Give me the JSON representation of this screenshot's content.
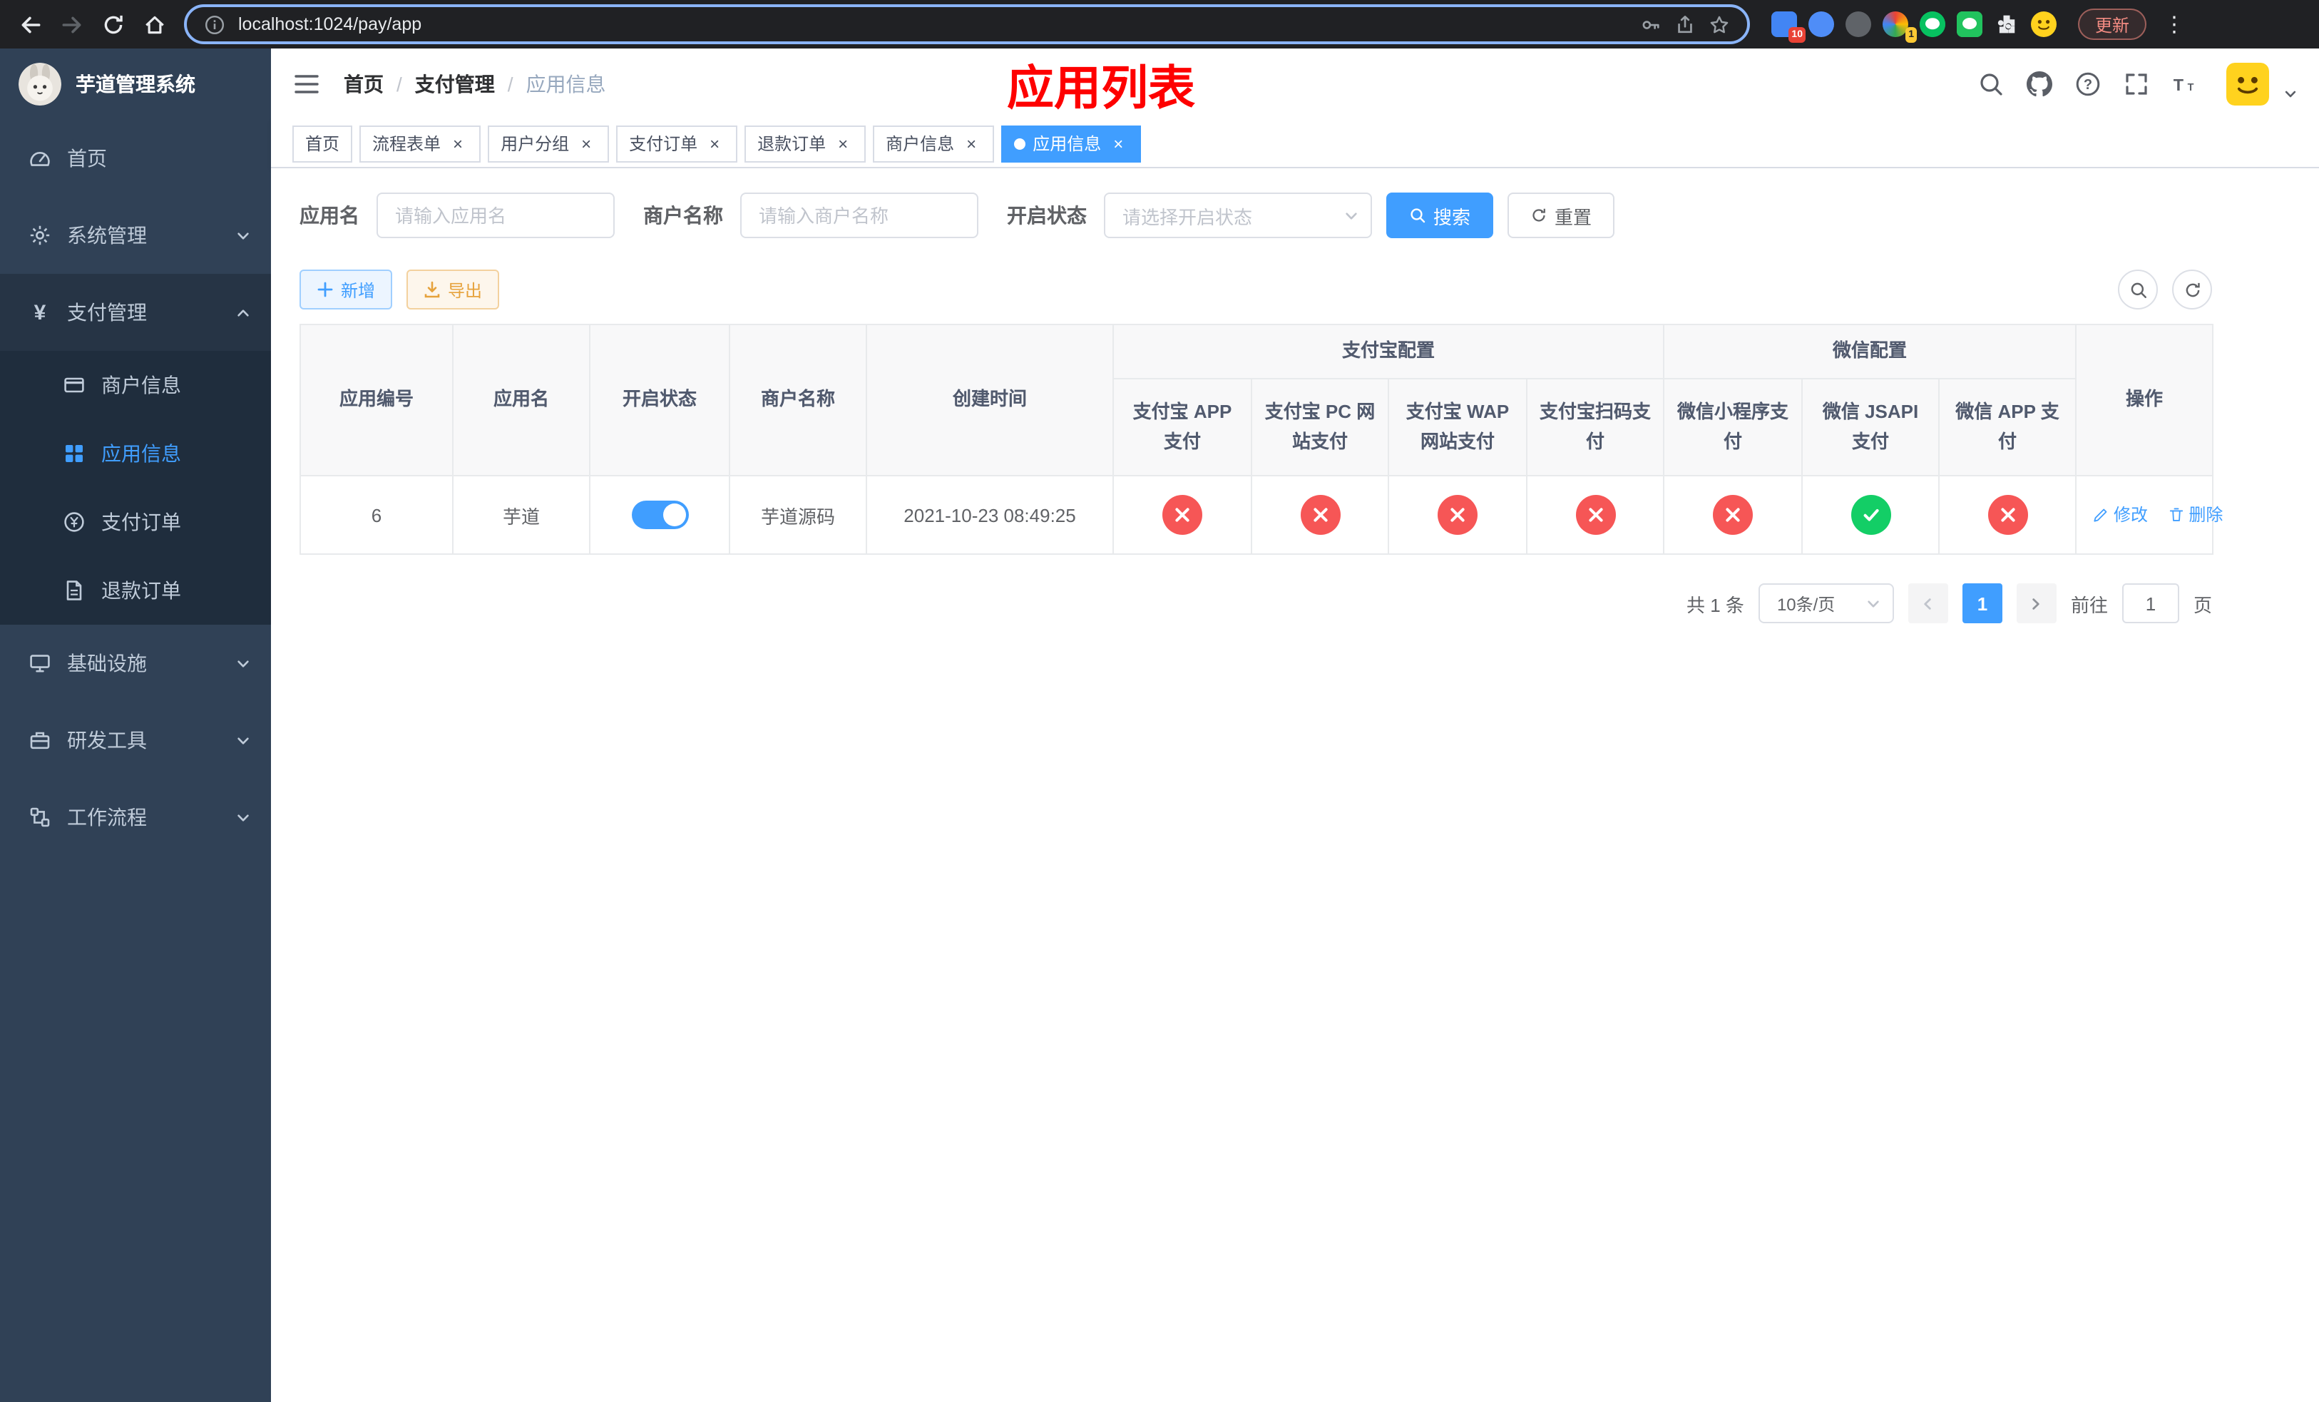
{
  "colors": {
    "accent": "#409EFF",
    "danger": "#f65656",
    "success": "#13ce66",
    "annotation": "#fe0000",
    "sidebar": "#304156"
  },
  "browser": {
    "url": "localhost:1024/pay/app",
    "update_label": "更新",
    "extension_badges": {
      "apps": "10",
      "colorful": "1"
    }
  },
  "sidebar": {
    "title": "芋道管理系统",
    "items": [
      {
        "label": "首页"
      },
      {
        "label": "系统管理"
      },
      {
        "label": "支付管理",
        "state": "expanded",
        "children": [
          {
            "label": "商户信息"
          },
          {
            "label": "应用信息",
            "state": "active"
          },
          {
            "label": "支付订单"
          },
          {
            "label": "退款订单"
          }
        ]
      },
      {
        "label": "基础设施"
      },
      {
        "label": "研发工具"
      },
      {
        "label": "工作流程"
      }
    ]
  },
  "header": {
    "breadcrumb": [
      "首页",
      "支付管理",
      "应用信息"
    ],
    "separator": "/",
    "annotation": "应用列表"
  },
  "tabs": [
    {
      "label": "首页"
    },
    {
      "label": "流程表单"
    },
    {
      "label": "用户分组"
    },
    {
      "label": "支付订单"
    },
    {
      "label": "退款订单"
    },
    {
      "label": "商户信息"
    },
    {
      "label": "应用信息",
      "state": "active"
    }
  ],
  "filters": {
    "app_name": {
      "label": "应用名",
      "placeholder": "请输入应用名"
    },
    "merchant_name": {
      "label": "商户名称",
      "placeholder": "请输入商户名称"
    },
    "status": {
      "label": "开启状态",
      "placeholder": "请选择开启状态"
    },
    "search": "搜索",
    "reset": "重置"
  },
  "toolbar": {
    "add": "新增",
    "export": "导出"
  },
  "table": {
    "groups": {
      "alipay": "支付宝配置",
      "wechat": "微信配置"
    },
    "columns": [
      "应用编号",
      "应用名",
      "开启状态",
      "商户名称",
      "创建时间",
      "支付宝 APP 支付",
      "支付宝 PC 网站支付",
      "支付宝 WAP 网站支付",
      "支付宝扫码支付",
      "微信小程序支付",
      "微信 JSAPI 支付",
      "微信 APP 支付",
      "操作"
    ],
    "rows": [
      {
        "id": "6",
        "name": "芋道",
        "switch": "on",
        "merchant": "芋道源码",
        "created": "2021-10-23 08:49:25",
        "statuses": [
          "fail",
          "fail",
          "fail",
          "fail",
          "fail",
          "success",
          "fail"
        ],
        "edit": "修改",
        "delete": "删除"
      }
    ]
  },
  "pagination": {
    "total": "共 1 条",
    "page_size": "10条/页",
    "page": "1",
    "goto": "前往",
    "goto_value": "1",
    "unit": "页"
  }
}
